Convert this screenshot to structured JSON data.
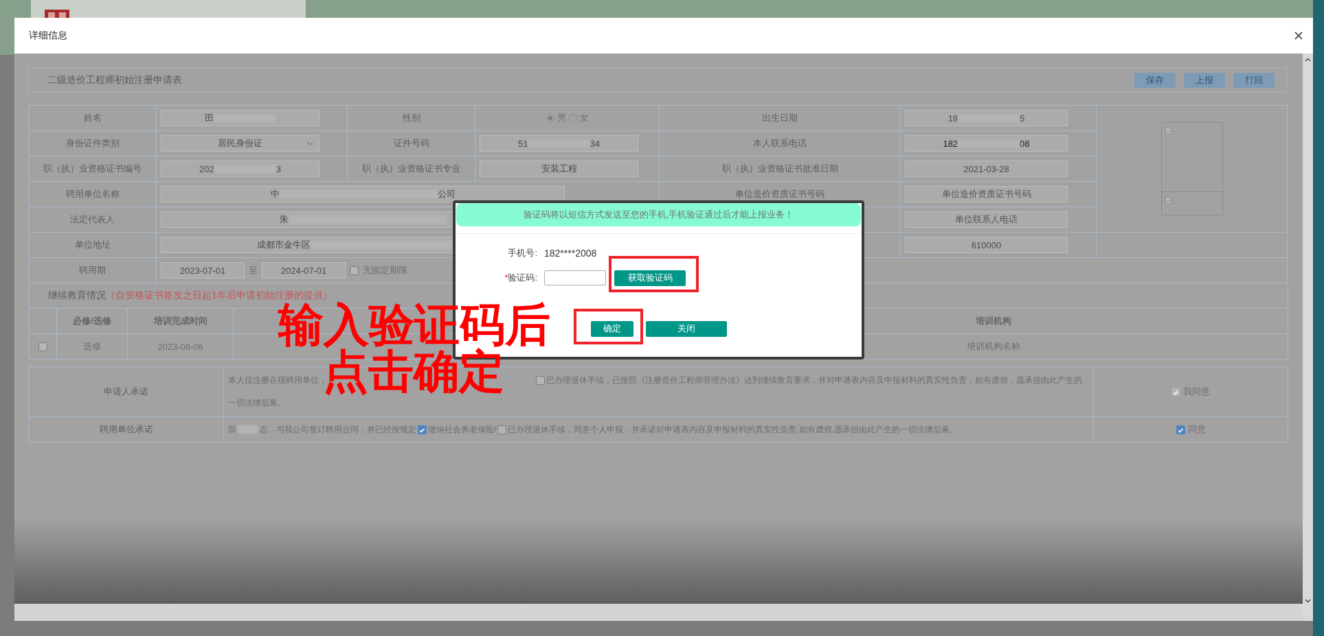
{
  "modal": {
    "title": "详细信息"
  },
  "form": {
    "title": "二级造价工程师初始注册申请表",
    "actions": [
      {
        "label": "保存"
      },
      {
        "label": "上报"
      },
      {
        "label": "打回"
      }
    ]
  },
  "rows": [
    {
      "kind": "triple",
      "cells": [
        {
          "kind": "input",
          "label": "姓名",
          "value": "田",
          "masked": true,
          "editable": false
        },
        {
          "kind": "radio",
          "label": "性别",
          "options": [
            {
              "label": "男",
              "selected": true
            },
            {
              "label": "女",
              "selected": false
            }
          ]
        },
        {
          "kind": "input",
          "label": "出生日期",
          "value": "19",
          "masked": true,
          "value_end": "5",
          "editable": false
        }
      ]
    },
    {
      "kind": "triple",
      "cells": [
        {
          "kind": "select",
          "label": "身份证件类别",
          "value": "居民身份证"
        },
        {
          "kind": "input",
          "label": "证件号码",
          "value": "51",
          "masked": true,
          "value_end": "34",
          "editable": false
        },
        {
          "kind": "input",
          "label": "本人联系电话",
          "value": "182",
          "masked": true,
          "value_end": "08",
          "editable": true
        }
      ]
    },
    {
      "kind": "triple",
      "cells": [
        {
          "kind": "input",
          "label": "职（执）业资格证书编号",
          "value": "202",
          "masked": true,
          "value_end": "3",
          "editable": false
        },
        {
          "kind": "input",
          "label": "职（执）业资格证书专业",
          "value": "安装工程",
          "masked": false,
          "editable": false
        },
        {
          "kind": "input",
          "label": "职（执）业资格证书批准日期",
          "value": "2021-03-28",
          "masked": false,
          "editable": false
        }
      ]
    },
    {
      "kind": "wide",
      "cells": [
        {
          "kind": "input",
          "label": "聘用单位名称",
          "value": "中",
          "masked": true,
          "value_end": "公司",
          "editable": false
        },
        {
          "kind": "input",
          "label": "单位造价资质证书号码",
          "placeholder": "单位造价资质证书号码",
          "masked": false
        }
      ]
    },
    {
      "kind": "wide",
      "cells": [
        {
          "kind": "input",
          "label": "法定代表人",
          "value": "朱",
          "masked": true,
          "editable": false
        },
        {
          "kind": "input",
          "placeholder": "单位联系人电话",
          "masked": false
        }
      ]
    },
    {
      "kind": "wide",
      "cells": [
        {
          "kind": "input",
          "label": "单位地址",
          "value": "成都市金牛区",
          "masked": true,
          "editable": false
        },
        {
          "kind": "input",
          "value": "610000",
          "masked": false,
          "editable": false
        }
      ]
    },
    {
      "kind": "period",
      "label": "聘用期",
      "start": "2023-07-01",
      "separator": "至",
      "end": "2024-07-01",
      "open_ended": {
        "label": "无固定期限",
        "checked": false
      }
    }
  ],
  "education": {
    "title": "继续教育情况",
    "note": "（自资格证书签发之日起1年后申请初始注册的提供）",
    "columns": [
      "必修/选修",
      "培训完成时间",
      "培训机构"
    ],
    "rows": [
      {
        "checked": false,
        "type": "选修",
        "date": "2023-06-06",
        "institution": "培训机构名称"
      }
    ]
  },
  "pledges": [
    {
      "label": "申请人承诺",
      "parts": [
        {
          "kind": "text",
          "text": "本人仅注册在现聘用单位，"
        },
        {
          "kind": "gap"
        },
        {
          "kind": "check",
          "checked": false
        },
        {
          "kind": "text",
          "text": "已办理退休手续，已按照《注册造价工程师管理办法》达到继续教育要求，并对申请表内容及申报材料的真实性负责，如有虚假，愿承担由此产生的"
        },
        {
          "kind": "break"
        },
        {
          "kind": "text",
          "text": "一切法律后果。"
        }
      ],
      "agree": {
        "label": "我同意",
        "checked": true,
        "disabled": true
      }
    },
    {
      "label": "聘用单位承诺",
      "parts": [
        {
          "kind": "text",
          "text": "田"
        },
        {
          "kind": "mask"
        },
        {
          "kind": "text",
          "text": "志，与我公司签订聘用合同，并已经按规定"
        },
        {
          "kind": "check",
          "checked": true
        },
        {
          "kind": "text",
          "text": "缴纳社会养老保险/"
        },
        {
          "kind": "check",
          "checked": false
        },
        {
          "kind": "text",
          "text": "已办理退休手续，同意个人申报，并承诺对申请表内容及申报材料的真实性负责,如有虚假,愿承担由此产生的一切法律后果。"
        }
      ],
      "agree": {
        "label": "同意",
        "checked": true,
        "disabled": false
      }
    }
  ],
  "dialog": {
    "notice": "验证码将以短信方式发送至您的手机,手机验证通过后才能上报业务！",
    "phone_label": "手机号:",
    "phone": "182****2008",
    "code_label": "验证码:",
    "required_mark": "*",
    "send_button": "获取验证码",
    "send_highlighted": true,
    "confirm": "确定",
    "confirm_highlighted": true,
    "close": "关闭"
  },
  "annotation": {
    "lines": [
      "输入验证码后",
      "点击确定"
    ]
  }
}
